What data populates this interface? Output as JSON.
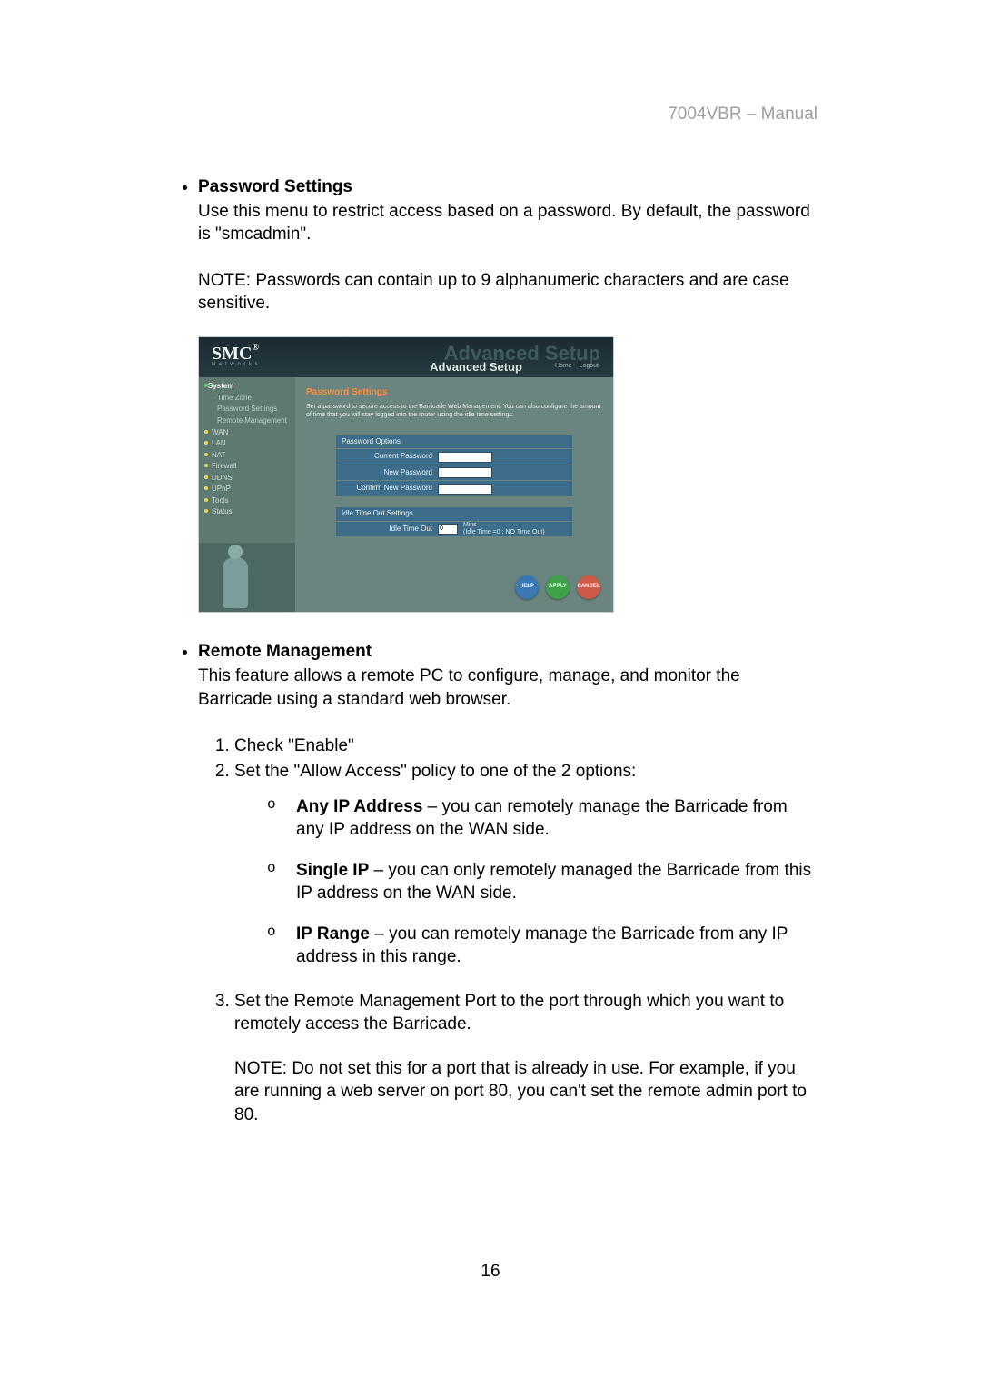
{
  "doc_header": "7004VBR – Manual",
  "page_number": "16",
  "section1": {
    "title": "Password Settings",
    "para": "Use this menu to restrict access based on a password. By default, the password is \"smcadmin\".",
    "note": "NOTE: Passwords can contain up to 9 alphanumeric characters and are case sensitive."
  },
  "section2": {
    "title": "Remote Management",
    "para": "This feature allows a remote PC to configure, manage, and monitor the Barricade using a standard web browser.",
    "step1": "Check \"Enable\"",
    "step2": "Set the \"Allow Access\" policy to one of the 2 options:",
    "opt1_title": "Any IP Address",
    "opt1_rest": " – you can remotely manage the Barricade from any IP address on the WAN side.",
    "opt2_title": "Single IP",
    "opt2_rest": " – you can only remotely managed the Barricade from this IP address on the WAN side.",
    "opt3_title": "IP Range",
    "opt3_rest": " – you can remotely manage the Barricade from any IP address in this range.",
    "step3": "Set the Remote Management Port to the port through which you want to remotely access the Barricade.",
    "step3_note": "NOTE: Do not set this for a port that is already in use.  For example, if you are running a web server on port 80, you can't set the remote admin port to 80."
  },
  "screenshot": {
    "logo": "SMC",
    "logo_reg": "®",
    "logo_sub": "N e t w o r k s",
    "title_bg": "Advanced Setup",
    "title_fg": "Advanced Setup",
    "link_home": "Home",
    "link_logout": "Logout",
    "sidebar": {
      "system": "System",
      "time_zone": "Time Zone",
      "password_settings": "Password Settings",
      "remote_mgmt": "Remote Management",
      "wan": "WAN",
      "lan": "LAN",
      "nat": "NAT",
      "firewall": "Firewall",
      "ddns": "DDNS",
      "upnp": "UPnP",
      "tools": "Tools",
      "status": "Status"
    },
    "main": {
      "title": "Password Settings",
      "desc": "Set a password to secure access to the Barricade Web Management. You can also configure the amount of time that you will stay logged into the router using the idle time settings.",
      "box_pw_header": "Password Options",
      "row_current": "Current Password",
      "row_new": "New Password",
      "row_confirm": "Confirm New Password",
      "box_idle_header": "Idle Time Out Settings",
      "row_idle": "Idle Time Out",
      "idle_value": "0",
      "idle_unit": "Mins",
      "idle_note": "(Idle Time =0 : NO Time Out)"
    },
    "buttons": {
      "help": "HELP",
      "apply": "APPLY",
      "cancel": "CANCEL"
    }
  }
}
